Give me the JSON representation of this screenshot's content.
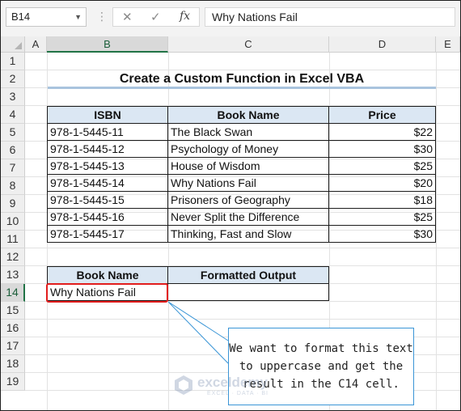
{
  "formula_bar": {
    "name_box": "B14",
    "cancel_icon": "✕",
    "enter_icon": "✓",
    "fx_label": "fx",
    "formula": "Why Nations Fail"
  },
  "columns": [
    "A",
    "B",
    "C",
    "D",
    "E"
  ],
  "selected_column": "B",
  "rows": [
    "1",
    "2",
    "3",
    "4",
    "5",
    "6",
    "7",
    "8",
    "9",
    "10",
    "11",
    "12",
    "13",
    "14",
    "15",
    "16",
    "17",
    "18",
    "19"
  ],
  "selected_row": "14",
  "title": "Create a Custom Function in Excel VBA",
  "main_table": {
    "headers": [
      "ISBN",
      "Book Name",
      "Price"
    ],
    "rows": [
      [
        "978-1-5445-11",
        "The Black Swan",
        "$22"
      ],
      [
        "978-1-5445-12",
        "Psychology of Money",
        "$30"
      ],
      [
        "978-1-5445-13",
        "House of Wisdom",
        "$25"
      ],
      [
        "978-1-5445-14",
        "Why Nations Fail",
        "$20"
      ],
      [
        "978-1-5445-15",
        "Prisoners of Geography",
        "$18"
      ],
      [
        "978-1-5445-16",
        "Never Split the Difference",
        "$25"
      ],
      [
        "978-1-5445-17",
        "Thinking, Fast and Slow",
        "$30"
      ]
    ]
  },
  "output_table": {
    "headers": [
      "Book Name",
      "Formatted Output"
    ],
    "row": [
      "Why Nations Fail",
      ""
    ]
  },
  "callout": {
    "line1": "We want to format this text",
    "line2": "to uppercase and get the",
    "line3": "result in the C14 cell."
  },
  "watermark": {
    "name": "exceldemy",
    "tagline": "EXCEL · DATA · BI"
  },
  "colors": {
    "header_fill": "#dbe7f3",
    "selection_green": "#217346",
    "highlight_red": "#e21d1d",
    "callout_blue": "#3a95d6"
  }
}
